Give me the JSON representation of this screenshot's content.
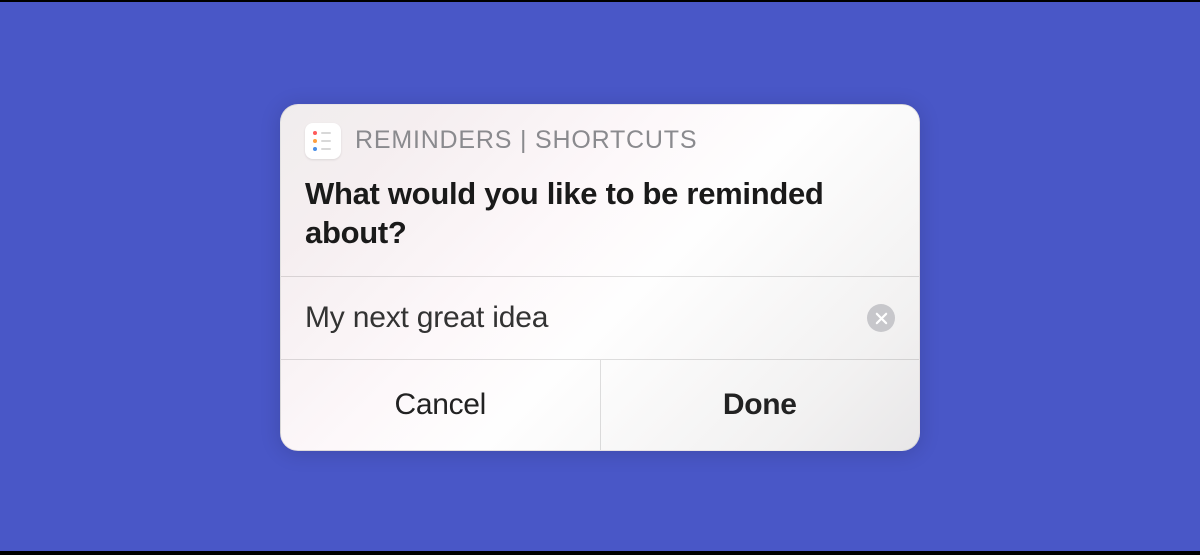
{
  "header": {
    "app_title": "REMINDERS | SHORTCUTS"
  },
  "prompt": {
    "text": "What would you like to be reminded about?"
  },
  "input": {
    "value": "My next great idea"
  },
  "buttons": {
    "cancel": "Cancel",
    "done": "Done"
  }
}
